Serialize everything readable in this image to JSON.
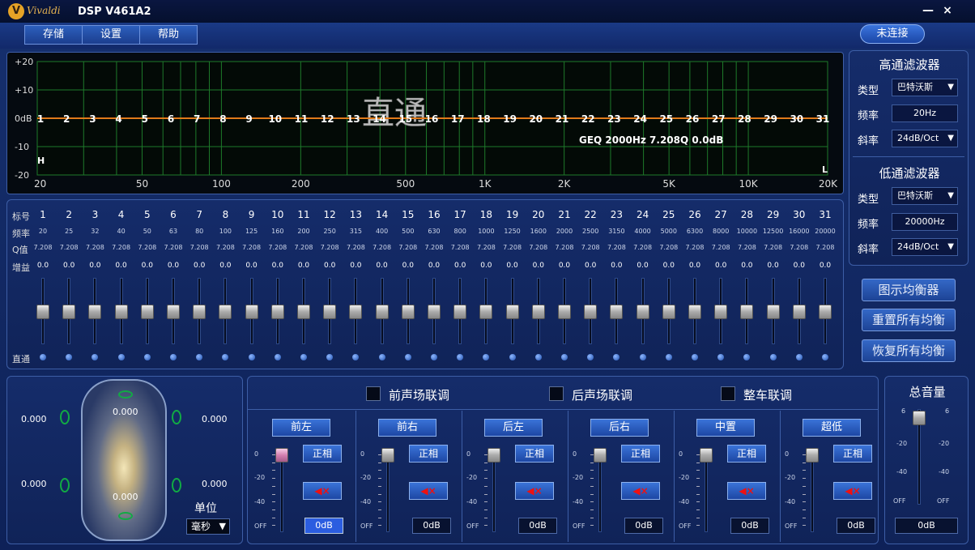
{
  "titlebar": {
    "brand": "Vivaldi",
    "title": "DSP V461A2",
    "minimize": "—",
    "close": "×"
  },
  "menu": {
    "items": [
      "存储",
      "设置",
      "帮助"
    ]
  },
  "connect": {
    "label": "未连接"
  },
  "graph": {
    "ylabels": [
      "+20",
      "+10",
      "0dB",
      "-10",
      "-20"
    ],
    "xlabels": [
      "20",
      "50",
      "100",
      "200",
      "500",
      "1K",
      "2K",
      "5K",
      "10K",
      "20K"
    ],
    "band_numbers": [
      "1",
      "2",
      "3",
      "4",
      "5",
      "6",
      "7",
      "8",
      "9",
      "10",
      "11",
      "12",
      "13",
      "14",
      "15",
      "16",
      "17",
      "18",
      "19",
      "20",
      "21",
      "22",
      "23",
      "24",
      "25",
      "26",
      "27",
      "28",
      "29",
      "30",
      "31"
    ],
    "watermark": "直通",
    "info": "GEQ 2000Hz 7.208Q 0.0dB",
    "h_marker": "H",
    "l_marker": "L"
  },
  "bands": {
    "row_labels": {
      "number": "标号",
      "freq": "频率",
      "q": "Q值",
      "gain": "增益",
      "bypass": "直通"
    },
    "numbers": [
      "1",
      "2",
      "3",
      "4",
      "5",
      "6",
      "7",
      "8",
      "9",
      "10",
      "11",
      "12",
      "13",
      "14",
      "15",
      "16",
      "17",
      "18",
      "19",
      "20",
      "21",
      "22",
      "23",
      "24",
      "25",
      "26",
      "27",
      "28",
      "29",
      "30",
      "31"
    ],
    "freqs": [
      "20",
      "25",
      "32",
      "40",
      "50",
      "63",
      "80",
      "100",
      "125",
      "160",
      "200",
      "250",
      "315",
      "400",
      "500",
      "630",
      "800",
      "1000",
      "1250",
      "1600",
      "2000",
      "2500",
      "3150",
      "4000",
      "5000",
      "6300",
      "8000",
      "10000",
      "12500",
      "16000",
      "20000"
    ],
    "q": [
      "7.208",
      "7.208",
      "7.208",
      "7.208",
      "7.208",
      "7.208",
      "7.208",
      "7.208",
      "7.208",
      "7.208",
      "7.208",
      "7.208",
      "7.208",
      "7.208",
      "7.208",
      "7.208",
      "7.208",
      "7.208",
      "7.208",
      "7.208",
      "7.208",
      "7.208",
      "7.208",
      "7.208",
      "7.208",
      "7.208",
      "7.208",
      "7.208",
      "7.208",
      "7.208",
      "7.208"
    ],
    "gains": [
      "0.0",
      "0.0",
      "0.0",
      "0.0",
      "0.0",
      "0.0",
      "0.0",
      "0.0",
      "0.0",
      "0.0",
      "0.0",
      "0.0",
      "0.0",
      "0.0",
      "0.0",
      "0.0",
      "0.0",
      "0.0",
      "0.0",
      "0.0",
      "0.0",
      "0.0",
      "0.0",
      "0.0",
      "0.0",
      "0.0",
      "0.0",
      "0.0",
      "0.0",
      "0.0",
      "0.0"
    ]
  },
  "highpass": {
    "title": "高通滤波器",
    "type_label": "类型",
    "type": "巴特沃斯",
    "freq_label": "频率",
    "freq": "20Hz",
    "slope_label": "斜率",
    "slope": "24dB/Oct"
  },
  "lowpass": {
    "title": "低通滤波器",
    "type_label": "类型",
    "type": "巴特沃斯",
    "freq_label": "频率",
    "freq": "20000Hz",
    "slope_label": "斜率",
    "slope": "24dB/Oct"
  },
  "side_buttons": [
    "图示均衡器",
    "重置所有均衡",
    "恢复所有均衡"
  ],
  "car": {
    "values": [
      "0.000",
      "0.000",
      "0.000",
      "0.000",
      "0.000",
      "0.000"
    ],
    "unit_label": "单位",
    "unit": "毫秒"
  },
  "linkage": [
    "前声场联调",
    "后声场联调",
    "整车联调"
  ],
  "channels": [
    {
      "name": "前左",
      "phase": "正相",
      "db": "0dB"
    },
    {
      "name": "前右",
      "phase": "正相",
      "db": "0dB"
    },
    {
      "name": "后左",
      "phase": "正相",
      "db": "0dB"
    },
    {
      "name": "后右",
      "phase": "正相",
      "db": "0dB"
    },
    {
      "name": "中置",
      "phase": "正相",
      "db": "0dB"
    },
    {
      "name": "超低",
      "phase": "正相",
      "db": "0dB"
    }
  ],
  "channel_scale": [
    "0",
    "-20",
    "-40",
    "OFF"
  ],
  "master": {
    "title": "总音量",
    "scale": [
      "6",
      "-20",
      "-40",
      "OFF"
    ],
    "db": "0dB"
  },
  "colors": {
    "grid": "#1e7a2a",
    "curve": "#e07a1a",
    "accent": "#2b5de0"
  }
}
